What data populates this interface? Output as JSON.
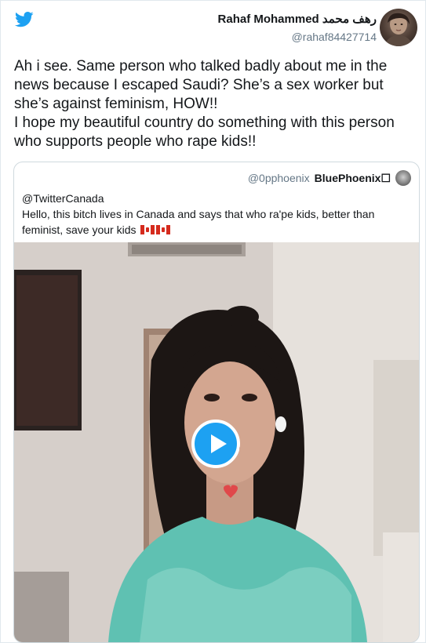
{
  "tweet": {
    "author": {
      "display_name": "Rahaf Mohammed رهف محمد",
      "handle": "@rahaf84427714",
      "avatar_icon": "avatar-photo"
    },
    "text": "Ah i see. Same person who talked badly about me in the news because I escaped Saudi? She’s a sex worker but she’s against feminism, HOW!!\nI hope my beautiful country do something with this person who supports people who rape kids!!",
    "platform_icon": "twitter-bird-icon",
    "accent_color": "#1da1f2"
  },
  "quoted_tweet": {
    "handle": "@0pphoenix",
    "display_name": "BluePhoenix☐",
    "mention": "@TwitterCanada",
    "text": "Hello, this bitch lives in Canada and says that who ra'pe kids, better than feminist, save your kids",
    "flags": [
      "canada-flag-icon",
      "canada-flag-icon"
    ],
    "video": {
      "play_icon": "play-icon"
    }
  }
}
